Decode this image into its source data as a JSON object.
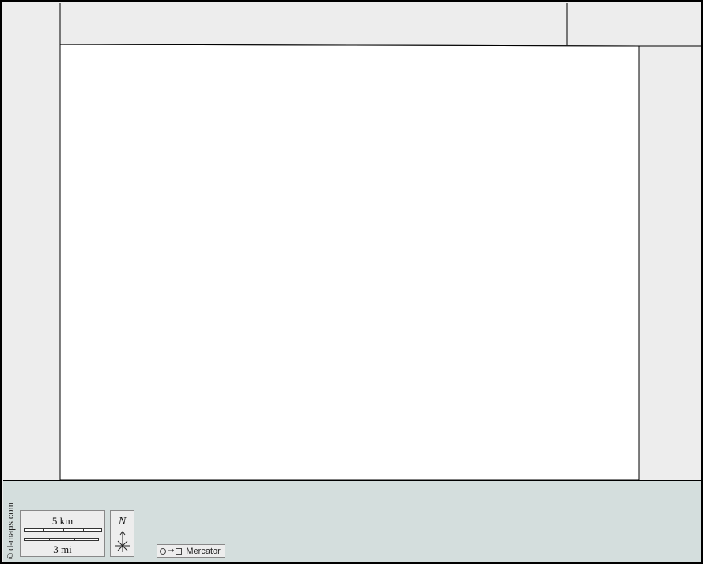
{
  "map": {
    "colors": {
      "land": "#ededed",
      "focus_area": "#ffffff",
      "water_band": "#d4dedd",
      "border": "#000000"
    },
    "credit": "© d-maps.com"
  },
  "scale": {
    "km_label": "5 km",
    "mi_label": "3 mi"
  },
  "north": {
    "letter": "N"
  },
  "projection": {
    "label": "Mercator",
    "circle_icon": "circle-icon",
    "arrow_icon": "arrow-right-icon",
    "square_icon": "square-icon"
  }
}
